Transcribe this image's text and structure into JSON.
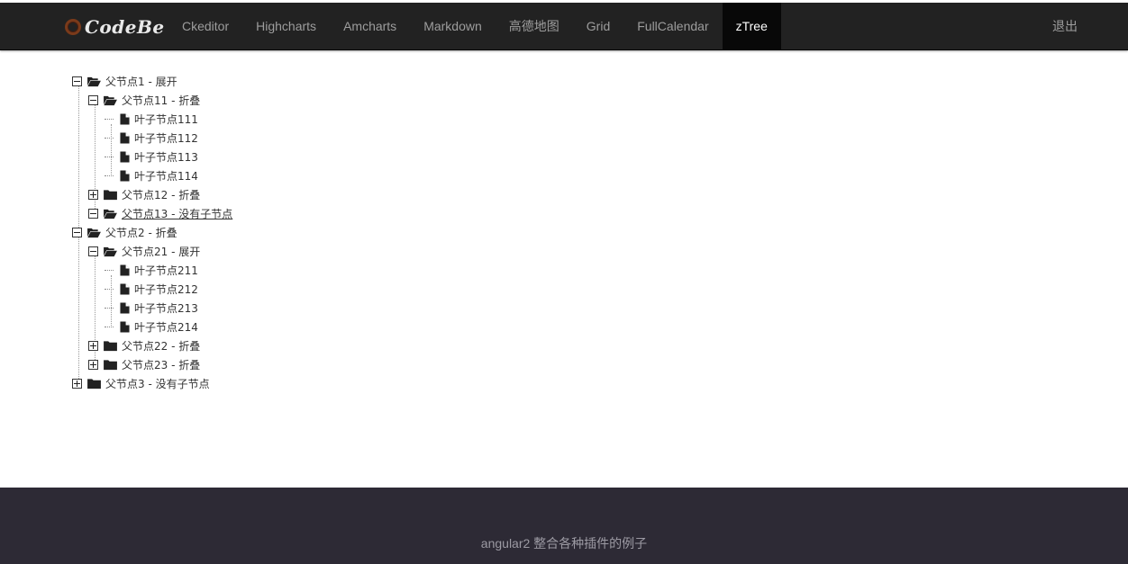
{
  "brand": {
    "name": "CodeBe"
  },
  "nav": {
    "items": [
      "Ckeditor",
      "Highcharts",
      "Amcharts",
      "Markdown",
      "高德地图",
      "Grid",
      "FullCalendar",
      "zTree"
    ],
    "active": "zTree",
    "logout": "退出"
  },
  "tree": {
    "n1": {
      "label": "父节点1 - 展开",
      "n11": {
        "label": "父节点11 - 折叠",
        "l111": "叶子节点111",
        "l112": "叶子节点112",
        "l113": "叶子节点113",
        "l114": "叶子节点114"
      },
      "n12": {
        "label": "父节点12 - 折叠"
      },
      "n13": {
        "label": "父节点13 - 没有子节点"
      }
    },
    "n2": {
      "label": "父节点2 - 折叠",
      "n21": {
        "label": "父节点21 - 展开",
        "l211": "叶子节点211",
        "l212": "叶子节点212",
        "l213": "叶子节点213",
        "l214": "叶子节点214"
      },
      "n22": {
        "label": "父节点22 - 折叠"
      },
      "n23": {
        "label": "父节点23 - 折叠"
      }
    },
    "n3": {
      "label": "父节点3 - 没有子节点"
    }
  },
  "footer": {
    "text": "angular2 整合各种插件的例子"
  },
  "icons": {
    "folder_open": "folder-open-icon",
    "folder_closed": "folder-icon",
    "file": "file-icon"
  },
  "colors": {
    "navbar": "#222222",
    "active_tab": "#080808",
    "footer": "#2d2a35"
  }
}
